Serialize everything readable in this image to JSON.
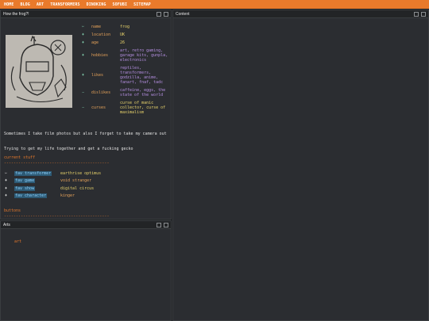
{
  "nav": [
    "HOME",
    "BLOG",
    "ART",
    "TRANSFORMERS",
    "DINOKING",
    "SOFUBI",
    "SITEMAP"
  ],
  "colors": {
    "accent": "#e97a2b",
    "key": "#e6a35a",
    "purple": "#b48ee0",
    "yellow": "#e8d36b",
    "teal": "#7cc2a5",
    "fav_bg": "#2d5a75"
  },
  "profile_window": {
    "title": "How the frog?!",
    "info": [
      {
        "icon": "✂",
        "key": "name",
        "value": "frog",
        "color": "#e8d36b"
      },
      {
        "icon": "♦",
        "key": "location",
        "value": "UK",
        "color": "#e8d36b"
      },
      {
        "icon": "♦",
        "key": "age",
        "value": "26",
        "color": "#e8d36b"
      },
      {
        "icon": "♦",
        "key": "hobbies",
        "value": "art, retro gaming, garage kits, gunpla, electronics",
        "color": "#b48ee0"
      },
      {
        "icon": "♦",
        "key": "likes",
        "value": "reptiles, transformers, godzilla, anime, fanart, fnaf, tadc",
        "color": "#b48ee0"
      },
      {
        "icon": "−",
        "key": "dislikes",
        "value": "caffeine, eggs, the state of the world",
        "color": "#b48ee0"
      },
      {
        "icon": "−",
        "key": "curses",
        "value": "curse of manic collector, curse of maximalism",
        "color": "#e8d36b"
      }
    ],
    "para1": "Sometimes I take film photos but also I forget to take my camera out",
    "para2": "Trying to get my life together and get a fucking gecko",
    "current_title": "current stuff",
    "dashes": "--------------------------------------------",
    "favs": [
      {
        "icon": "✂",
        "label": "fav transformer",
        "value": "earthrise optimus",
        "color": "#e8d36b"
      },
      {
        "icon": "♦",
        "label": "fav game",
        "value": "void stranger",
        "color": "#e6a35a"
      },
      {
        "icon": "♦",
        "label": "fav show",
        "value": "digital circus",
        "color": "#e8d36b"
      },
      {
        "icon": "♦",
        "label": "fav character",
        "value": "kinger",
        "color": "#e6a35a"
      }
    ],
    "buttons_title": "buttons"
  },
  "content_window": {
    "title": "Content"
  },
  "arts_window": {
    "title": "Arts",
    "link": "art"
  }
}
